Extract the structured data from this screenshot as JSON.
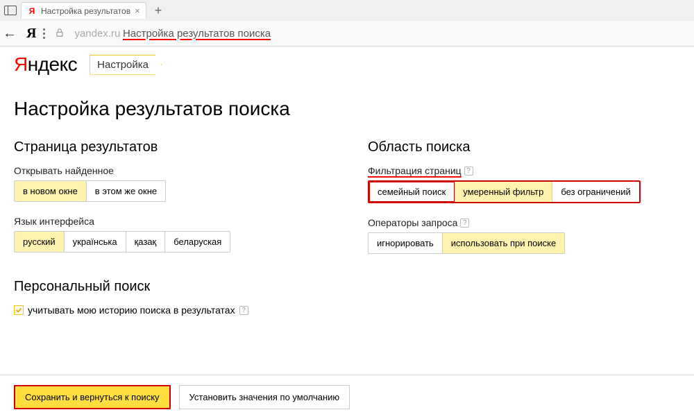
{
  "browser": {
    "tab_title": "Настройка результатов",
    "host": "yandex.ru",
    "path": "Настройка результатов поиска"
  },
  "header": {
    "logo_red": "Я",
    "logo_rest": "ндекс",
    "tag": "Настройка"
  },
  "page": {
    "title": "Настройка результатов поиска"
  },
  "results": {
    "section_title": "Страница результатов",
    "open_found_label": "Открывать найденное",
    "open_options": {
      "new_window": "в новом окне",
      "same_window": "в этом же окне"
    },
    "lang_label": "Язык интерфейса",
    "lang": {
      "ru": "русский",
      "uk": "українська",
      "kk": "қазақ",
      "be": "беларуская"
    }
  },
  "personal": {
    "section_title": "Персональный поиск",
    "history_label": "учитывать мою историю поиска в результатах"
  },
  "scope": {
    "section_title": "Область поиска",
    "filter_label": "Фильтрация страниц",
    "filter": {
      "family": "семейный поиск",
      "moderate": "умеренный фильтр",
      "none": "без ограничений"
    },
    "ops_label": "Операторы запроса",
    "ops": {
      "ignore": "игнорировать",
      "use": "использовать при поиске"
    }
  },
  "footer": {
    "save": "Сохранить и вернуться к поиску",
    "reset": "Установить значения по умолчанию"
  }
}
